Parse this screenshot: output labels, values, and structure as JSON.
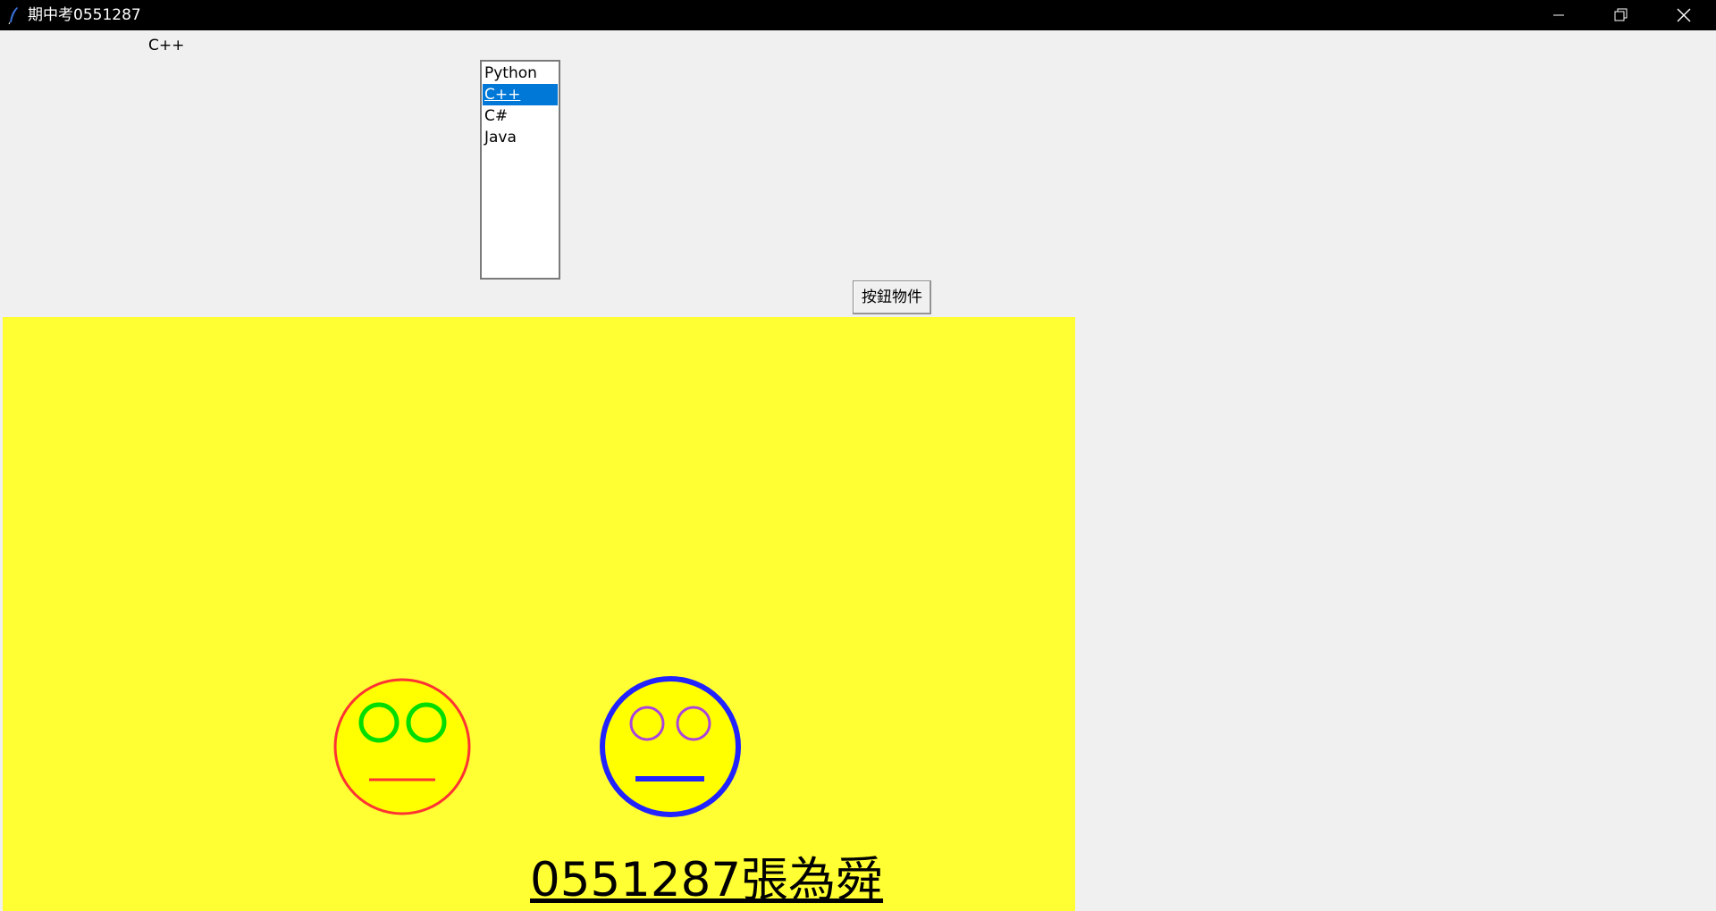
{
  "window": {
    "title": "期中考0551287",
    "controls": [
      "minimize",
      "restore",
      "close"
    ]
  },
  "selection_label": "C++",
  "listbox": {
    "items": [
      "Python",
      "C++",
      "C#",
      "Java"
    ],
    "selected": "C++"
  },
  "button": {
    "label": "按鈕物件"
  },
  "canvas": {
    "background": "#ffff33",
    "text": "0551287張為舜",
    "faces": [
      {
        "name": "left-face",
        "fill": "#ffff00",
        "outline": "#ff3333",
        "eyes": "#00dd00",
        "mouth": "#ff3333"
      },
      {
        "name": "right-face",
        "fill": "#ffff00",
        "outline": "#2222ff",
        "eyes": "#aa44dd",
        "mouth": "#2222ff"
      }
    ]
  },
  "colors": {
    "titlebar": "#000000",
    "selection_highlight": "#0078d7"
  }
}
